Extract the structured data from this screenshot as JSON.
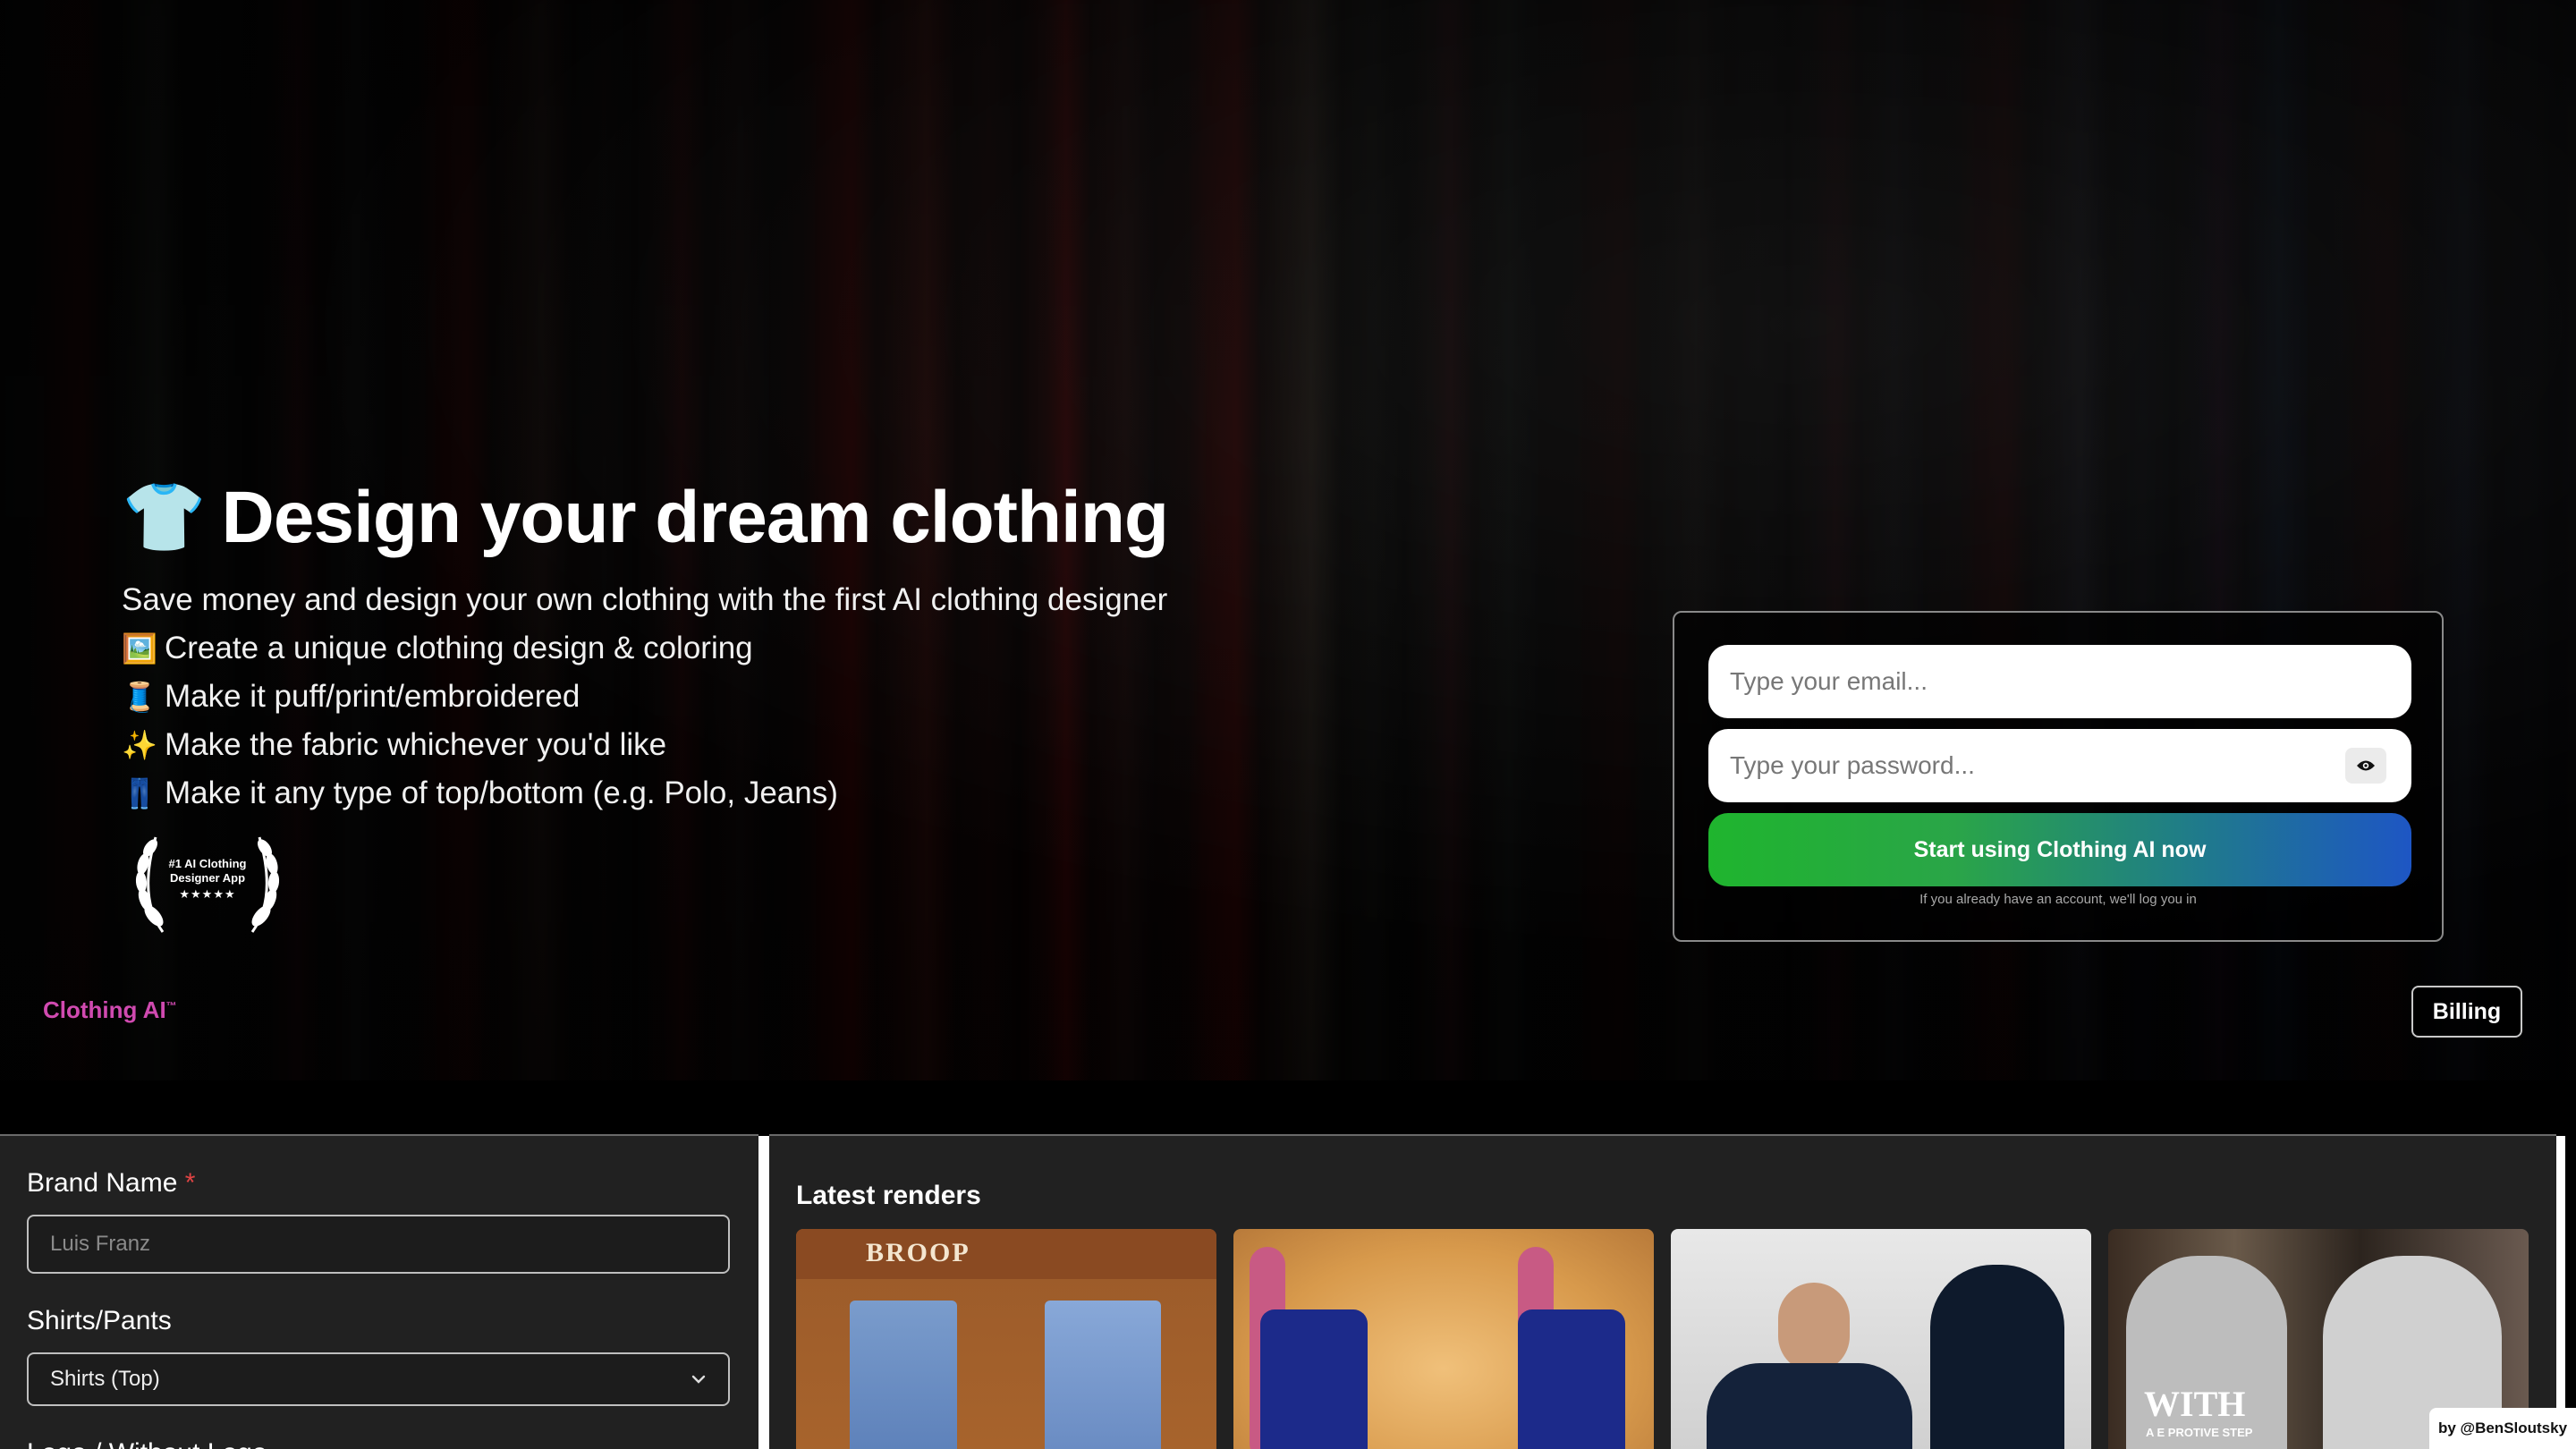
{
  "hero": {
    "title_emoji": "👕",
    "title": "Design your dream clothing",
    "subtitle": "Save money and design your own clothing with the first AI clothing designer",
    "features": [
      {
        "emoji": "🖼️",
        "text": "Create a unique clothing design & coloring"
      },
      {
        "emoji": "🧵",
        "text": "Make it puff/print/embroidered"
      },
      {
        "emoji": "✨",
        "text": "Make the fabric whichever you'd like"
      },
      {
        "emoji": "👖",
        "text": "Make it any type of top/bottom (e.g. Polo, Jeans)"
      }
    ],
    "award": {
      "line1": "#1 AI Clothing",
      "line2": "Designer App",
      "stars": "★★★★★"
    }
  },
  "brand": {
    "name": "Clothing AI",
    "mark": "™"
  },
  "billing_label": "Billing",
  "login": {
    "email_placeholder": "Type your email...",
    "password_placeholder": "Type your password...",
    "cta_label": "Start using Clothing AI now",
    "note": "If you already have an account, we'll log you in"
  },
  "form": {
    "brand_name_label": "Brand Name",
    "required_mark": "*",
    "brand_name_placeholder": "Luis Franz",
    "type_label": "Shirts/Pants",
    "type_value": "Shirts (Top)",
    "next_label": "Logo / Without Logo"
  },
  "renders": {
    "title": "Latest renders",
    "items": [
      {
        "caption": "BROOP"
      },
      {
        "caption": ""
      },
      {
        "caption": ""
      },
      {
        "caption": "WITH",
        "sub": "A E PROTIVE STEP"
      }
    ]
  },
  "credit": "by @BenSloutsky"
}
